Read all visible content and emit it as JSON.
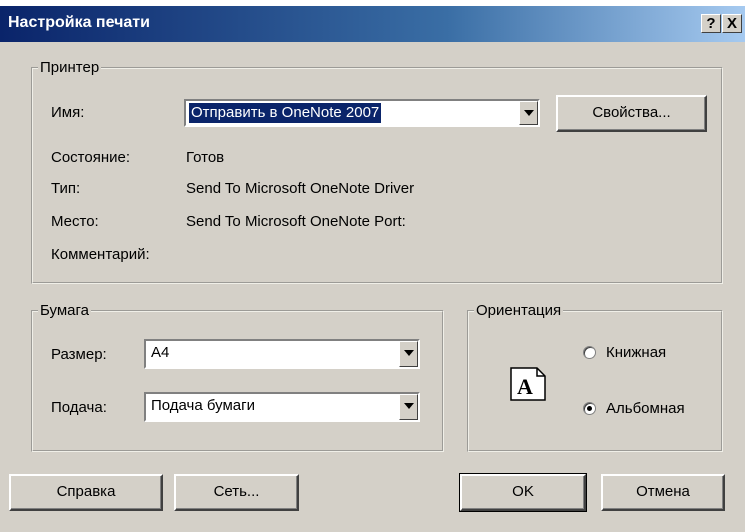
{
  "window": {
    "title": "Настройка печати",
    "help_glyph": "?",
    "close_glyph": "X"
  },
  "printer": {
    "group_label": "Принтер",
    "name_label": "Имя:",
    "name_value": "Отправить в OneNote 2007",
    "properties_button": "Свойства...",
    "status_label": "Состояние:",
    "status_value": "Готов",
    "type_label": "Тип:",
    "type_value": "Send To Microsoft OneNote Driver",
    "where_label": "Место:",
    "where_value": "Send To Microsoft OneNote Port:",
    "comment_label": "Комментарий:",
    "comment_value": ""
  },
  "paper": {
    "group_label": "Бумага",
    "size_label": "Размер:",
    "size_value": "A4",
    "source_label": "Подача:",
    "source_value": "Подача бумаги"
  },
  "orientation": {
    "group_label": "Ориентация",
    "icon_letter": "A",
    "portrait_label": "Книжная",
    "landscape_label": "Альбомная",
    "selected": "landscape"
  },
  "buttons": {
    "help": "Справка",
    "network": "Сеть...",
    "ok": "OK",
    "cancel": "Отмена"
  },
  "colors": {
    "title_bar": "#0a246a",
    "dialog_face": "#d4d0c8",
    "selection": "#0a246a"
  }
}
